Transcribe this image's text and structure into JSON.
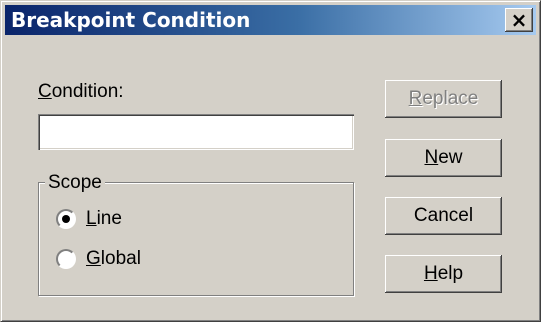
{
  "window": {
    "title": "Breakpoint Condition",
    "close_label": "×"
  },
  "condition": {
    "label_mnemonic": "C",
    "label_rest": "ondition:",
    "value": "",
    "placeholder": ""
  },
  "scope": {
    "legend": "Scope",
    "options": [
      {
        "mnemonic": "L",
        "rest": "ine",
        "selected": true
      },
      {
        "mnemonic": "G",
        "rest": "lobal",
        "selected": false
      }
    ]
  },
  "buttons": {
    "replace": {
      "mnemonic": "R",
      "rest": "eplace",
      "enabled": false
    },
    "new": {
      "mnemonic": "N",
      "rest": "ew",
      "enabled": true
    },
    "cancel": {
      "label": "Cancel",
      "enabled": true
    },
    "help": {
      "mnemonic": "H",
      "rest": "elp",
      "enabled": true
    }
  },
  "colors": {
    "face": "#d4d0c8",
    "title_start": "#0a246a",
    "title_end": "#a6caf0",
    "disabled_text": "#808080"
  }
}
